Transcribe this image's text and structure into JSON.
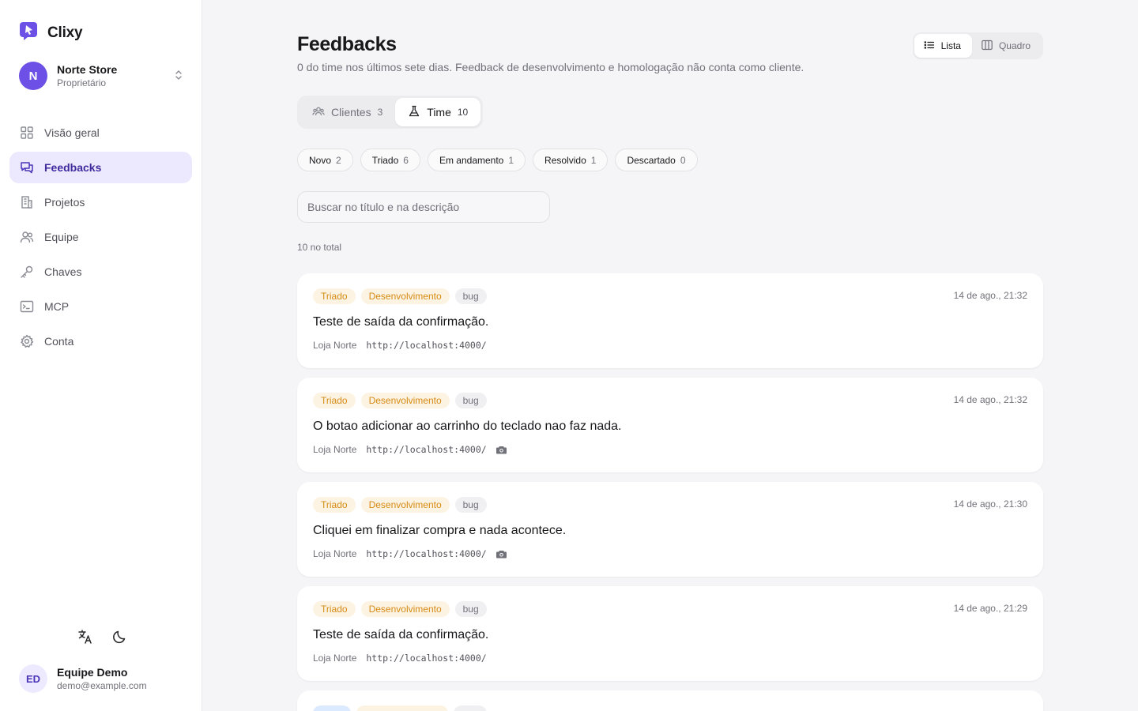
{
  "brand": {
    "name": "Clixy"
  },
  "org": {
    "initial": "N",
    "name": "Norte Store",
    "role": "Proprietário"
  },
  "nav": [
    {
      "label": "Visão geral",
      "icon": "grid-icon"
    },
    {
      "label": "Feedbacks",
      "icon": "chat-icon",
      "active": true
    },
    {
      "label": "Projetos",
      "icon": "building-icon"
    },
    {
      "label": "Equipe",
      "icon": "users-icon"
    },
    {
      "label": "Chaves",
      "icon": "key-icon"
    },
    {
      "label": "MCP",
      "icon": "terminal-icon"
    },
    {
      "label": "Conta",
      "icon": "gear-icon"
    }
  ],
  "user": {
    "initials": "ED",
    "name": "Equipe Demo",
    "email": "demo@example.com"
  },
  "header": {
    "title": "Feedbacks",
    "subtitle": "0 do time nos últimos sete dias. Feedback de desenvolvimento e homologação não conta como cliente."
  },
  "view_toggle": {
    "list": "Lista",
    "board": "Quadro",
    "active": "list"
  },
  "tabs": [
    {
      "label": "Clientes",
      "count": "3"
    },
    {
      "label": "Time",
      "count": "10",
      "active": true
    }
  ],
  "status_filters": [
    {
      "label": "Novo",
      "count": "2"
    },
    {
      "label": "Triado",
      "count": "6"
    },
    {
      "label": "Em andamento",
      "count": "1"
    },
    {
      "label": "Resolvido",
      "count": "1"
    },
    {
      "label": "Descartado",
      "count": "0"
    }
  ],
  "search": {
    "placeholder": "Buscar no título e na descrição"
  },
  "total": "10 no total",
  "feedbacks": [
    {
      "status": "Triado",
      "env": "Desenvolvimento",
      "type": "bug",
      "date": "14 de ago., 21:32",
      "title": "Teste de saída da confirmação.",
      "project": "Loja Norte",
      "url": "http://localhost:4000/",
      "has_screenshot": false
    },
    {
      "status": "Triado",
      "env": "Desenvolvimento",
      "type": "bug",
      "date": "14 de ago., 21:32",
      "title": "O botao adicionar ao carrinho do teclado nao faz nada.",
      "project": "Loja Norte",
      "url": "http://localhost:4000/",
      "has_screenshot": true
    },
    {
      "status": "Triado",
      "env": "Desenvolvimento",
      "type": "bug",
      "date": "14 de ago., 21:30",
      "title": "Cliquei em finalizar compra e nada acontece.",
      "project": "Loja Norte",
      "url": "http://localhost:4000/",
      "has_screenshot": true
    },
    {
      "status": "Triado",
      "env": "Desenvolvimento",
      "type": "bug",
      "date": "14 de ago., 21:29",
      "title": "Teste de saída da confirmação.",
      "project": "Loja Norte",
      "url": "http://localhost:4000/",
      "has_screenshot": false
    }
  ],
  "colors": {
    "accent": "#6d50e6",
    "active_nav_bg": "#ece8fd",
    "badge_warning": "#d58b14",
    "badge_info": "#2563eb"
  }
}
